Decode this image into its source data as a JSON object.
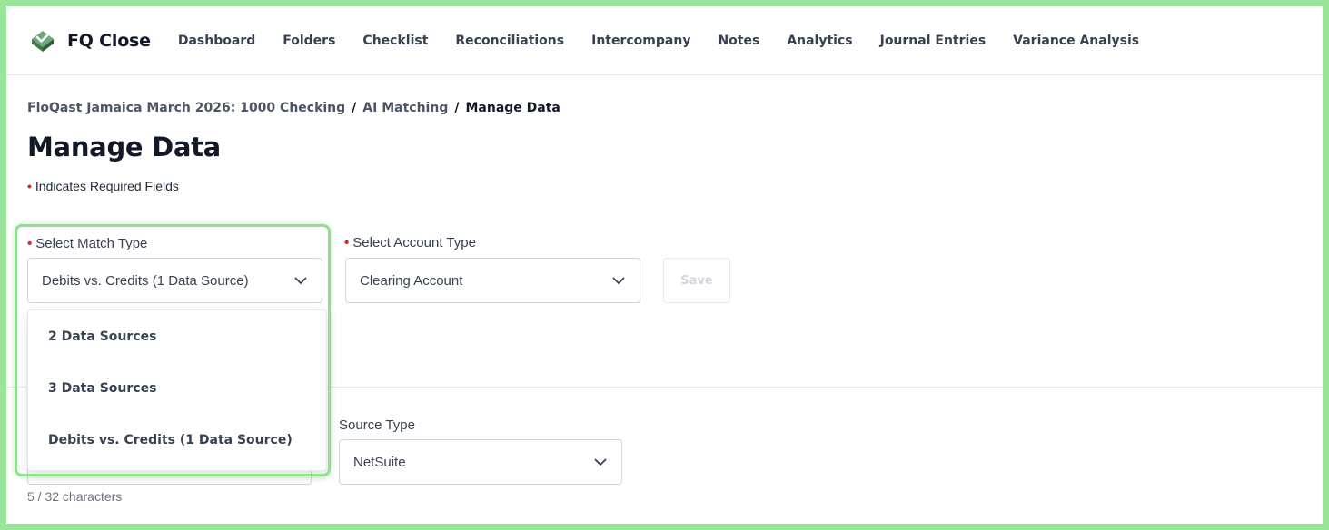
{
  "brand": {
    "name": "FQ Close",
    "accent": "#4a9b5a"
  },
  "nav": {
    "items": [
      {
        "label": "Dashboard"
      },
      {
        "label": "Folders"
      },
      {
        "label": "Checklist"
      },
      {
        "label": "Reconciliations"
      },
      {
        "label": "Intercompany"
      },
      {
        "label": "Notes"
      },
      {
        "label": "Analytics"
      },
      {
        "label": "Journal Entries"
      },
      {
        "label": "Variance Analysis"
      }
    ]
  },
  "breadcrumb": {
    "items": [
      {
        "label": "FloQast Jamaica March 2026: 1000 Checking"
      },
      {
        "label": "AI Matching"
      }
    ],
    "separator": "/",
    "current": "Manage Data"
  },
  "page": {
    "title": "Manage Data",
    "required_note": "Indicates Required Fields",
    "required_color": "#dc2626"
  },
  "form": {
    "match_type": {
      "label": "Select Match Type",
      "value": "Debits vs. Credits (1 Data Source)",
      "options": [
        {
          "label": "2 Data Sources"
        },
        {
          "label": "3 Data Sources"
        },
        {
          "label": "Debits vs. Credits (1 Data Source)"
        }
      ]
    },
    "account_type": {
      "label": "Select Account Type",
      "value": "Clearing Account"
    },
    "save_label": "Save",
    "source_type": {
      "label": "Source Type",
      "value": "NetSuite"
    },
    "char_count": "5 / 32 characters"
  }
}
